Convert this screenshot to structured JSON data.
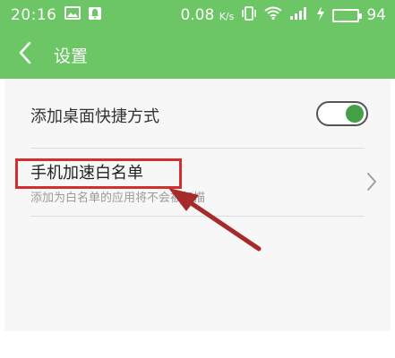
{
  "status_bar": {
    "time": "20:16",
    "network_speed": "0.08",
    "speed_unit": "K/s",
    "battery_level": "94",
    "icons": [
      "image-icon",
      "notification-icon",
      "vibrate-icon",
      "wifi-icon",
      "signal-icon",
      "charging-icon",
      "battery-icon"
    ]
  },
  "header": {
    "title": "设置",
    "back_icon": "chevron-left-icon"
  },
  "settings": {
    "shortcut": {
      "label": "添加桌面快捷方式",
      "toggle_on": true
    },
    "whitelist": {
      "label": "手机加速白名单",
      "description": "添加为白名单的应用将不会被扫描",
      "chevron_icon": "chevron-right-icon"
    }
  },
  "colors": {
    "header_bg": "#6cc666",
    "toggle_on": "#43a047",
    "annotation": "#d32f2f",
    "annotation_arrow": "#a52a2a"
  }
}
